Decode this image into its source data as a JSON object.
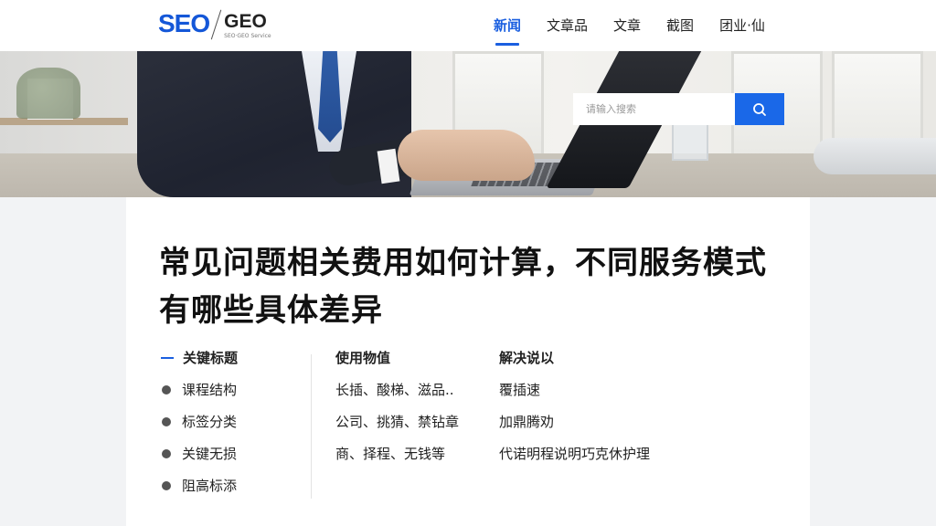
{
  "logo": {
    "seo": "SEO",
    "geo": "GEO",
    "tagline": "SEO·GEO Service"
  },
  "nav": {
    "items": [
      "新闻",
      "文章品",
      "文章",
      "截图",
      "团业·仙"
    ]
  },
  "search": {
    "placeholder": "请输入搜索"
  },
  "article": {
    "title": "常见问题相关费用如何计算，不同服务模式有哪些具体差异"
  },
  "columns": {
    "col1": {
      "heading": "关键标题",
      "items": [
        "课程结构",
        "标签分类",
        "关键无损",
        "阻高标添"
      ]
    },
    "col2": {
      "heading": "使用物值",
      "items": [
        "长插、酸梯、滋品..",
        "公司、挑猜、禁钻章",
        "商、择程、无钱等"
      ]
    },
    "col3": {
      "heading": "解决说以",
      "items": [
        "覆插速",
        "加鼎腾劝",
        "代诺明程说明巧克休护理"
      ]
    }
  },
  "colors": {
    "accent": "#1a5fe0",
    "search_button": "#1a68e8",
    "logo_seo": "#1457d8"
  },
  "icons": {
    "search": "search-icon"
  }
}
